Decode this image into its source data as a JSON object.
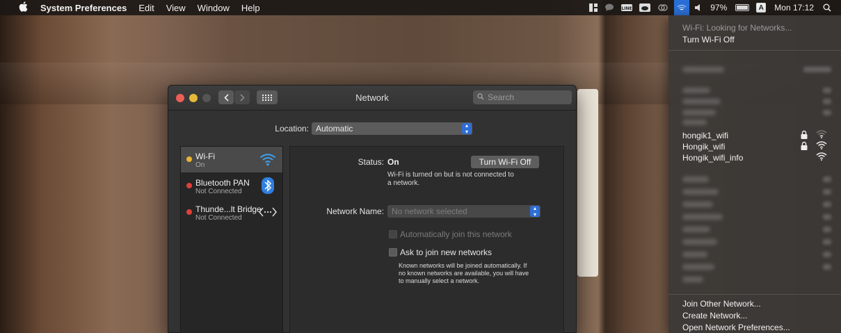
{
  "menubar": {
    "app_name": "System Preferences",
    "menus": [
      "Edit",
      "View",
      "Window",
      "Help"
    ],
    "status": {
      "battery": "97%",
      "input_source": "A",
      "clock": "Mon 17:12",
      "app_icons": [
        "split-view-icon",
        "chat-bubble-icon",
        "line-app-icon",
        "cloud-icon",
        "creative-cloud-icon"
      ]
    }
  },
  "window": {
    "title": "Network",
    "search_placeholder": "Search",
    "location_label": "Location:",
    "location_value": "Automatic",
    "services": [
      {
        "name": "Wi-Fi",
        "status": "On",
        "dot_color": "#e9b431",
        "icon": "wifi-icon"
      },
      {
        "name": "Bluetooth PAN",
        "status": "Not Connected",
        "dot_color": "#e0403a",
        "icon": "bluetooth-icon"
      },
      {
        "name": "Thunde...lt Bridge",
        "status": "Not Connected",
        "dot_color": "#e0403a",
        "icon": "thunderbolt-bridge-icon"
      }
    ],
    "detail": {
      "status_label": "Status:",
      "status_value": "On",
      "toggle_button": "Turn Wi-Fi Off",
      "status_note_1": "Wi-Fi is turned on but is not connected to",
      "status_note_2": "a network.",
      "network_name_label": "Network Name:",
      "network_name_placeholder": "No network selected",
      "auto_join_label": "Automatically join this network",
      "ask_join_label": "Ask to join new networks",
      "ask_note_1": "Known networks will be joined automatically. If",
      "ask_note_2": "no known networks are available, you will have",
      "ask_note_3": "to manually select a network."
    }
  },
  "wifi_menu": {
    "status_text": "Wi-Fi: Looking for Networks...",
    "toggle": "Turn Wi-Fi Off",
    "networks": [
      {
        "name": "hongik1_wifi",
        "locked": true,
        "signal": 1
      },
      {
        "name": "Hongik_wifi",
        "locked": true,
        "signal": 3
      },
      {
        "name": "Hongik_wifi_info",
        "locked": false,
        "signal": 3
      }
    ],
    "join_other": "Join Other Network...",
    "create": "Create Network...",
    "open_prefs": "Open Network Preferences..."
  },
  "colors": {
    "accent": "#2f6ed6",
    "close": "#ec5e56",
    "minimize": "#e4b93a"
  }
}
